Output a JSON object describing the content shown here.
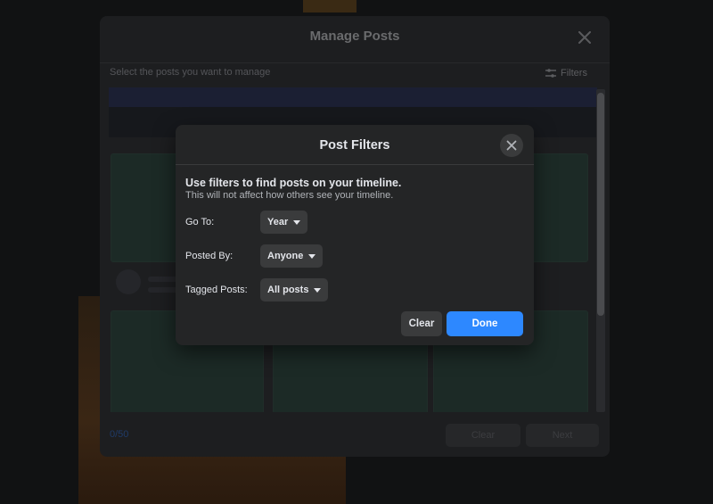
{
  "manage_posts": {
    "title": "Manage Posts",
    "subtitle": "Select the posts you want to manage",
    "filters_label": "Filters",
    "selected_count": "0/50",
    "clear_label": "Clear",
    "next_label": "Next"
  },
  "post_filters": {
    "title": "Post Filters",
    "heading": "Use filters to find posts on your timeline.",
    "subheading": "This will not affect how others see your timeline.",
    "filters": [
      {
        "label": "Go To:",
        "value": "Year"
      },
      {
        "label": "Posted By:",
        "value": "Anyone"
      },
      {
        "label": "Tagged Posts:",
        "value": "All posts"
      }
    ],
    "clear_label": "Clear",
    "done_label": "Done"
  },
  "colors": {
    "accent": "#2d88ff",
    "dialog_bg": "#242526",
    "control_bg": "#3a3b3c"
  }
}
